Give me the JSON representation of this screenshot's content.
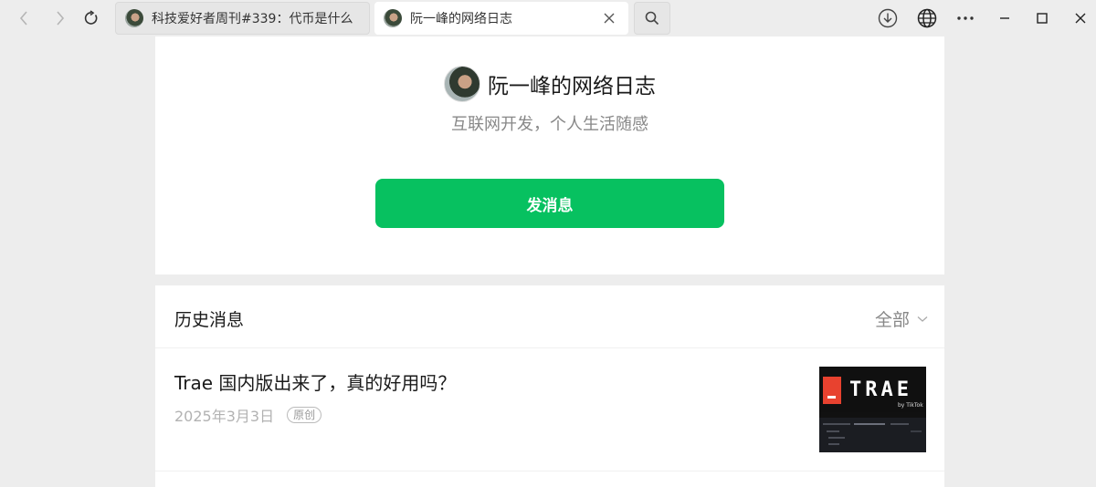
{
  "browser": {
    "tabs": [
      {
        "label": "科技爱好者周刊#339：代币是什么"
      },
      {
        "label": "阮一峰的网络日志"
      }
    ]
  },
  "profile": {
    "name": "阮一峰的网络日志",
    "description": "互联网开发，个人生活随感",
    "send_button": "发消息"
  },
  "history": {
    "title": "历史消息",
    "filter": "全部",
    "articles": [
      {
        "title": "Trae 国内版出来了，真的好用吗？",
        "date": "2025年3月3日",
        "tag": "原创",
        "thumbnail": {
          "logo": "TRAE",
          "sub": "by TikTok"
        }
      }
    ]
  },
  "colors": {
    "accent": "#07c160",
    "background": "#ededed",
    "thumb_red": "#e8422f"
  }
}
